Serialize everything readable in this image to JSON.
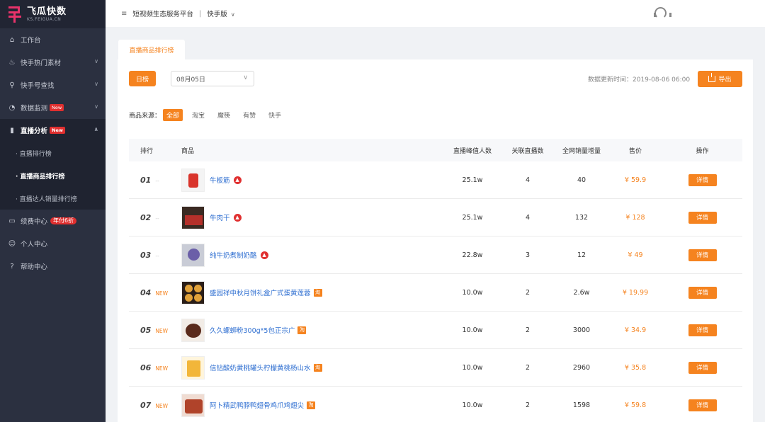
{
  "logo": {
    "title": "飞瓜快数",
    "subtitle": "KS.FEIGUA.CN"
  },
  "sidebar": {
    "items": [
      {
        "label": "工作台"
      },
      {
        "label": "快手热门素材"
      },
      {
        "label": "快手号查找"
      },
      {
        "label": "数据监测",
        "badge": "New"
      },
      {
        "label": "直播分析",
        "badge": "New"
      },
      {
        "label": "续费中心",
        "badge": "年付6折"
      },
      {
        "label": "个人中心"
      },
      {
        "label": "帮助中心"
      }
    ],
    "sub_items": [
      {
        "label": "· 直播排行榜"
      },
      {
        "label": "· 直播商品排行榜"
      },
      {
        "label": "· 直播达人销量排行榜"
      }
    ]
  },
  "topbar": {
    "menu_icon": "≡",
    "platform": "短视频生态服务平台",
    "separator": "|",
    "version": "快手版"
  },
  "tab": {
    "label": "直播商品排行榜"
  },
  "toolbar": {
    "daily_label": "日榜",
    "date_value": "08月05日",
    "update_time": "数据更新时间：2019-08-06 06:00",
    "export_label": "导出"
  },
  "source": {
    "label": "商品来源：",
    "options": [
      "全部",
      "淘宝",
      "魔筷",
      "有赞",
      "快手"
    ]
  },
  "table": {
    "headers": [
      "排行",
      "商品",
      "直播峰值人数",
      "关联直播数",
      "全网销量增量",
      "售价",
      "操作"
    ],
    "detail_label": "详情",
    "rows": [
      {
        "rank": "01",
        "tag": "--",
        "name": "牛板筋",
        "peak": "25.1w",
        "lives": "4",
        "sales": "40",
        "price": "¥ 59.9",
        "icon": "fire-icon"
      },
      {
        "rank": "02",
        "tag": "--",
        "name": "牛肉干",
        "peak": "25.1w",
        "lives": "4",
        "sales": "132",
        "price": "¥ 128",
        "icon": "fire-icon"
      },
      {
        "rank": "03",
        "tag": "--",
        "name": "纯牛奶煮制奶酪",
        "peak": "22.8w",
        "lives": "3",
        "sales": "12",
        "price": "¥ 49",
        "icon": "fire-icon"
      },
      {
        "rank": "04",
        "tag": "NEW",
        "name": "盛园祥中秋月饼礼盒广式蛋黄莲蓉",
        "peak": "10.0w",
        "lives": "2",
        "sales": "2.6w",
        "price": "¥ 19.99",
        "icon": "taobao-icon"
      },
      {
        "rank": "05",
        "tag": "NEW",
        "name": "久久螺蛳粉300g*5包正宗广",
        "peak": "10.0w",
        "lives": "2",
        "sales": "3000",
        "price": "¥ 34.9",
        "icon": "taobao-icon"
      },
      {
        "rank": "06",
        "tag": "NEW",
        "name": "信钻酸奶黄桃罐头柠檬黄桃杨山水",
        "peak": "10.0w",
        "lives": "2",
        "sales": "2960",
        "price": "¥ 35.8",
        "icon": "taobao-icon"
      },
      {
        "rank": "07",
        "tag": "NEW",
        "name": "阿卜精武鸭脖鸭翅骨鸡爪鸡翅尖",
        "peak": "10.0w",
        "lives": "2",
        "sales": "1598",
        "price": "¥ 59.8",
        "icon": "taobao-icon"
      }
    ]
  },
  "icons": {
    "fire_glyph": "▲",
    "taobao_glyph": "淘"
  },
  "colors": {
    "accent": "#f5831f",
    "sidebar_bg": "#2b3040",
    "link": "#2f6fd1",
    "badge_red": "#e02f2f",
    "brand_pink": "#e8336b"
  }
}
